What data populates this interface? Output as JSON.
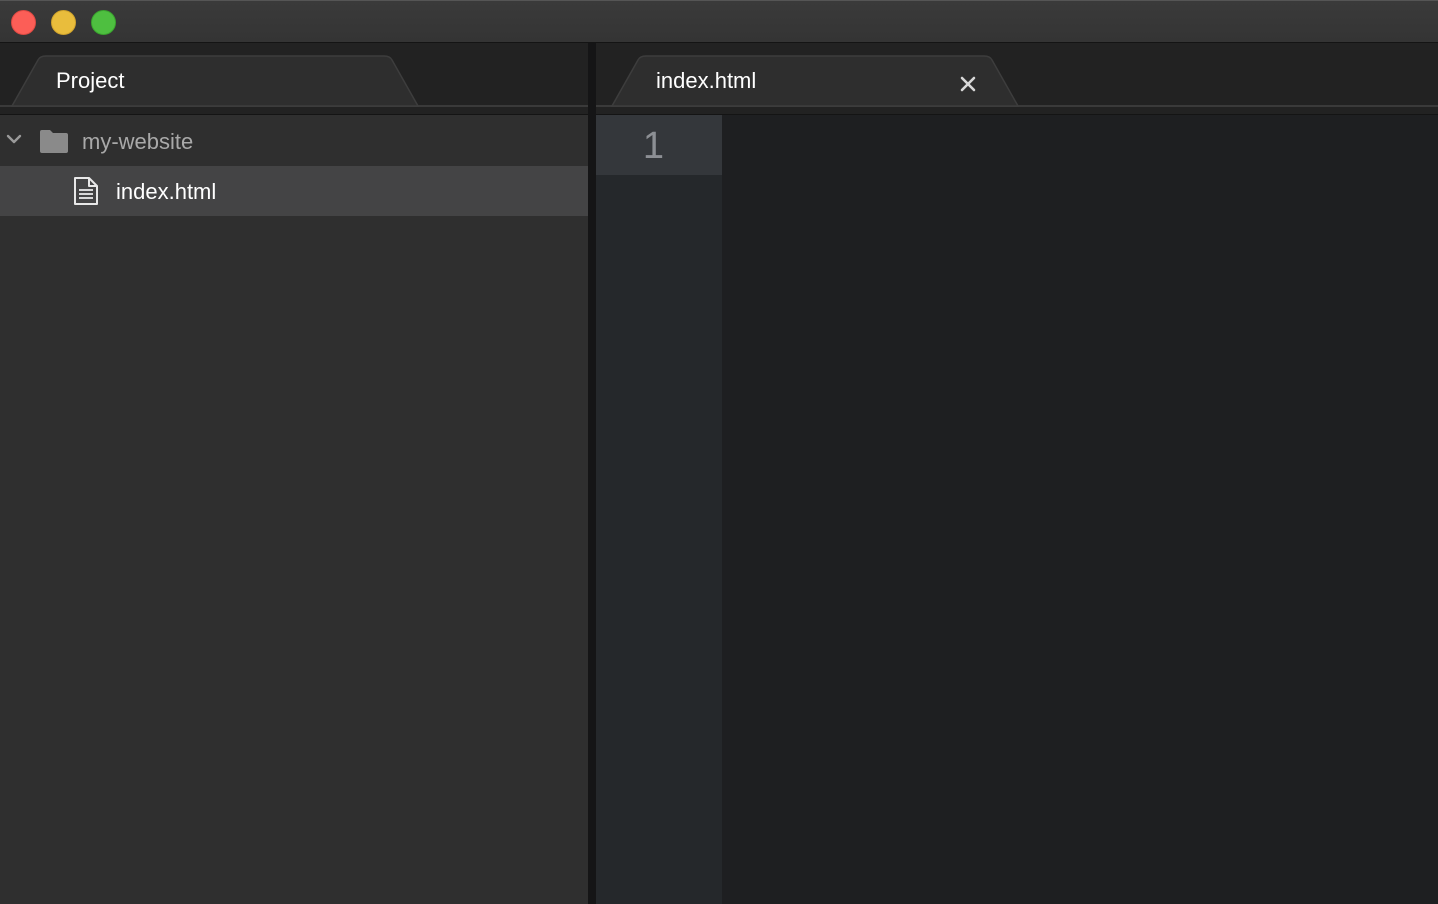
{
  "window": {
    "controls": {
      "close_color": "#fc5e57",
      "minimize_color": "#e9bd3c",
      "zoom_color": "#4ebf40"
    }
  },
  "sidebar": {
    "tab_label": "Project",
    "tree": {
      "folder": {
        "name": "my-website",
        "expanded": true,
        "icon": "folder-icon",
        "chevron_icon": "chevron-down-icon"
      },
      "files": [
        {
          "name": "index.html",
          "icon": "file-text-icon",
          "selected": true
        }
      ]
    }
  },
  "editor": {
    "tabs": [
      {
        "label": "index.html",
        "close_icon": "close-icon",
        "active": true
      }
    ],
    "line_numbers": [
      "1"
    ]
  },
  "theme": {
    "sidebar_bg": "#2f2f2f",
    "selection_bg": "#444445",
    "editor_bg": "#1e1f21",
    "gutter_bg": "#25282b"
  }
}
